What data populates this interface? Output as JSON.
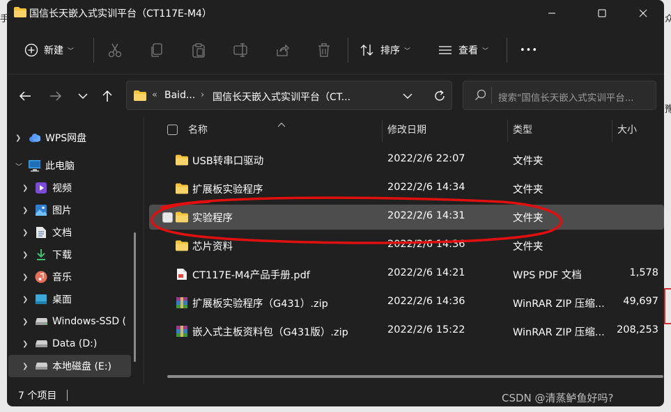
{
  "window": {
    "title": "国信长天嵌入式实训平台（CT117E-M4）",
    "controls": [
      "minimize",
      "maximize",
      "close"
    ]
  },
  "toolbar": {
    "new_label": "新建",
    "sort_label": "排序",
    "view_label": "查看",
    "more_label": "•••",
    "icons": [
      "cut-icon",
      "copy-icon",
      "paste-icon",
      "rename-icon",
      "share-icon",
      "delete-icon"
    ]
  },
  "address": {
    "crumb_prefix": "«",
    "crumbs": [
      "Baid...",
      "国信长天嵌入式实训平台（CT..."
    ],
    "separator": "›"
  },
  "search": {
    "placeholder": "搜索\"国信长天嵌入式实训平台..."
  },
  "sidebar": {
    "items": [
      {
        "label": "WPS网盘",
        "icon": "cloud-icon"
      },
      {
        "label": "此电脑",
        "icon": "computer-icon"
      },
      {
        "label": "视频",
        "icon": "video-icon"
      },
      {
        "label": "图片",
        "icon": "picture-icon"
      },
      {
        "label": "文档",
        "icon": "document-icon"
      },
      {
        "label": "下载",
        "icon": "download-icon"
      },
      {
        "label": "音乐",
        "icon": "music-icon"
      },
      {
        "label": "桌面",
        "icon": "desktop-icon"
      },
      {
        "label": "Windows-SSD (",
        "icon": "drive-icon"
      },
      {
        "label": "Data (D:)",
        "icon": "drive-icon"
      },
      {
        "label": "本地磁盘 (E:)",
        "icon": "drive-icon"
      }
    ]
  },
  "columns": {
    "name": "名称",
    "date": "修改日期",
    "type": "类型",
    "size": "大小"
  },
  "files": [
    {
      "name": "USB转串口驱动",
      "date": "2022/2/6 22:07",
      "type": "文件夹",
      "size": "",
      "icon": "folder-icon"
    },
    {
      "name": "扩展板实验程序",
      "date": "2022/2/6 14:34",
      "type": "文件夹",
      "size": "",
      "icon": "folder-icon"
    },
    {
      "name": "实验程序",
      "date": "2022/2/6 14:31",
      "type": "文件夹",
      "size": "",
      "icon": "folder-icon"
    },
    {
      "name": "芯片资料",
      "date": "2022/2/6 14:36",
      "type": "文件夹",
      "size": "",
      "icon": "folder-icon"
    },
    {
      "name": "CT117E-M4产品手册.pdf",
      "date": "2022/2/6 14:21",
      "type": "WPS PDF 文档",
      "size": "1,578",
      "icon": "pdf-icon"
    },
    {
      "name": "扩展板实验程序（G431）.zip",
      "date": "2022/2/6 14:36",
      "type": "WinRAR ZIP 压缩...",
      "size": "49,697",
      "icon": "archive-icon"
    },
    {
      "name": "嵌入式主板资料包（G431版）.zip",
      "date": "2022/2/6 15:22",
      "type": "WinRAR ZIP 压缩...",
      "size": "208,253",
      "icon": "archive-icon"
    }
  ],
  "selected_file": "实验程序",
  "status": {
    "count": "7 个项目"
  },
  "background": {
    "left_char": "手",
    "right_char": "众",
    "right_char2": "豫"
  },
  "watermark": "CSDN @清蒸鲈鱼好吗?",
  "colors": {
    "window_bg": "#202020",
    "selected_row": "#4d4d4d",
    "folder": "#f4c53d",
    "annotation": "#e01010"
  }
}
